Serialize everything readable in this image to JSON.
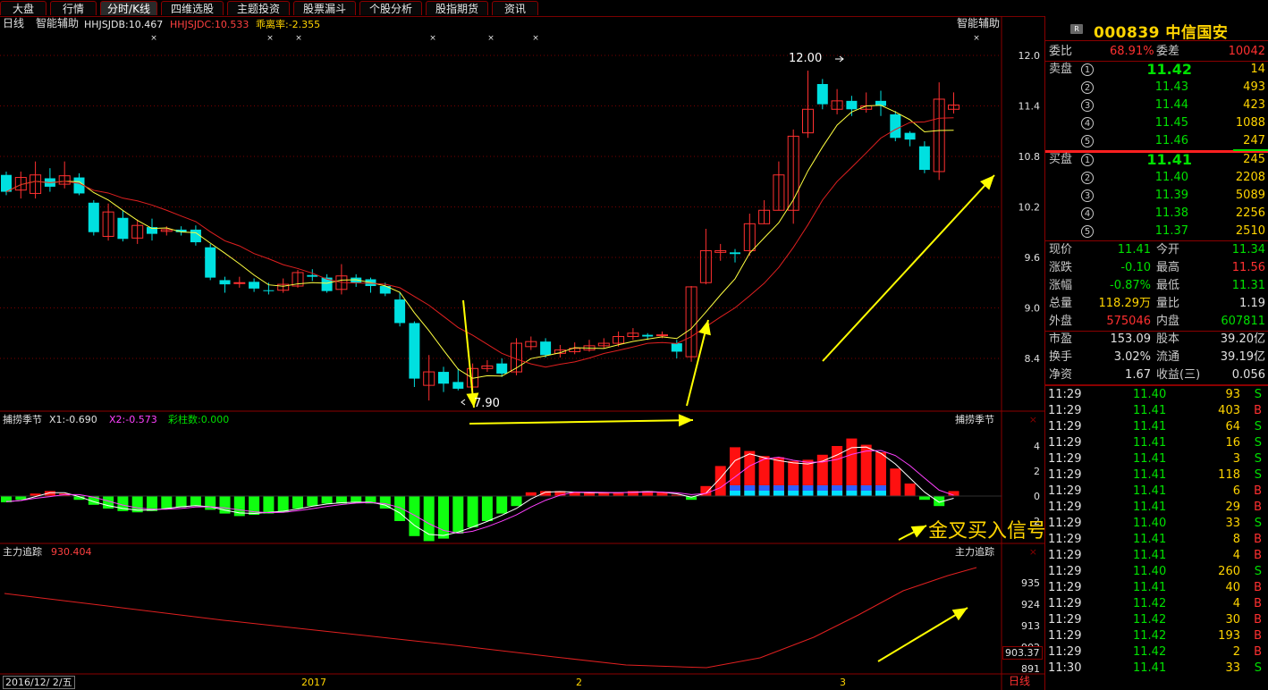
{
  "tabs": [
    "大盘",
    "行情",
    "分时/K线",
    "四维选股",
    "主题投资",
    "股票漏斗",
    "个股分析",
    "股指期货",
    "资讯"
  ],
  "active_tab": "分时/K线",
  "main_pane": {
    "period": "日线",
    "indicator": "智能辅助",
    "hhjsjdb": "HHJSJDB:10.467",
    "hhjsjdc": "HHJSJDC:10.533",
    "deviation": "乖离率:-2.355",
    "right_label": "智能辅助",
    "y_ticks": [
      "12.0",
      "11.4",
      "10.8",
      "10.2",
      "9.6",
      "9.0",
      "8.4"
    ],
    "high_label": "12.00",
    "low_label": "7.90"
  },
  "macd_pane": {
    "name": "捕捞季节",
    "x1": "X1:-0.690",
    "x2": "X2:-0.573",
    "colorbar": "彩柱数:0.000",
    "right_label": "捕捞季节",
    "y_ticks": [
      "4",
      "2",
      "0",
      "-2"
    ],
    "annotation": "金叉买入信号"
  },
  "flow_pane": {
    "name": "主力追踪",
    "value": "930.404",
    "right_label": "主力追踪",
    "y_ticks": [
      "935",
      "924",
      "913",
      "902",
      "891"
    ],
    "current": "903.37"
  },
  "x_axis": {
    "date": "2016/12/ 2/五",
    "labels": [
      "2017",
      "2",
      "3"
    ],
    "period_tag": "日线"
  },
  "stock": {
    "badge": "R",
    "code": "000839",
    "name": "中信国安"
  },
  "order_book": {
    "wb_label": "委比",
    "wb": "68.91%",
    "wc_label": "委差",
    "wc": "10042",
    "sell_label": "卖盘",
    "buy_label": "买盘",
    "asks": [
      {
        "level": "5",
        "price": "11.46",
        "vol": "247"
      },
      {
        "level": "4",
        "price": "11.45",
        "vol": "1088"
      },
      {
        "level": "3",
        "price": "11.44",
        "vol": "423"
      },
      {
        "level": "2",
        "price": "11.43",
        "vol": "493"
      },
      {
        "level": "1",
        "price": "11.42",
        "vol": "14"
      }
    ],
    "bids": [
      {
        "level": "1",
        "price": "11.41",
        "vol": "245"
      },
      {
        "level": "2",
        "price": "11.40",
        "vol": "2208"
      },
      {
        "level": "3",
        "price": "11.39",
        "vol": "5089"
      },
      {
        "level": "4",
        "price": "11.38",
        "vol": "2256"
      },
      {
        "level": "5",
        "price": "11.37",
        "vol": "2510"
      }
    ]
  },
  "quote": [
    {
      "l1": "现价",
      "v1": "11.41",
      "c1": "grn",
      "l2": "今开",
      "v2": "11.34",
      "c2": "grn"
    },
    {
      "l1": "涨跌",
      "v1": "-0.10",
      "c1": "grn",
      "l2": "最高",
      "v2": "11.56",
      "c2": "red"
    },
    {
      "l1": "涨幅",
      "v1": "-0.87%",
      "c1": "grn",
      "l2": "最低",
      "v2": "11.31",
      "c2": "grn"
    },
    {
      "l1": "总量",
      "v1": "118.29万",
      "c1": "yel",
      "l2": "量比",
      "v2": "1.19",
      "c2": "wht"
    },
    {
      "l1": "外盘",
      "v1": "575046",
      "c1": "red",
      "l2": "内盘",
      "v2": "607811",
      "c2": "grn"
    }
  ],
  "stats": [
    {
      "l1": "市盈",
      "v1": "153.09",
      "l2": "股本",
      "v2": "39.20亿"
    },
    {
      "l1": "换手",
      "v1": "3.02%",
      "l2": "流通",
      "v2": "39.19亿"
    },
    {
      "l1": "净资",
      "v1": "1.67",
      "l2": "收益(三)",
      "v2": "0.056"
    }
  ],
  "ticks": [
    {
      "t": "11:29",
      "p": "11.40",
      "v": "93",
      "s": "S"
    },
    {
      "t": "11:29",
      "p": "11.41",
      "v": "403",
      "s": "B"
    },
    {
      "t": "11:29",
      "p": "11.41",
      "v": "64",
      "s": "S"
    },
    {
      "t": "11:29",
      "p": "11.41",
      "v": "16",
      "s": "S"
    },
    {
      "t": "11:29",
      "p": "11.41",
      "v": "3",
      "s": "S"
    },
    {
      "t": "11:29",
      "p": "11.41",
      "v": "118",
      "s": "S"
    },
    {
      "t": "11:29",
      "p": "11.41",
      "v": "6",
      "s": "B"
    },
    {
      "t": "11:29",
      "p": "11.41",
      "v": "29",
      "s": "B"
    },
    {
      "t": "11:29",
      "p": "11.40",
      "v": "33",
      "s": "S"
    },
    {
      "t": "11:29",
      "p": "11.41",
      "v": "8",
      "s": "B"
    },
    {
      "t": "11:29",
      "p": "11.41",
      "v": "4",
      "s": "B"
    },
    {
      "t": "11:29",
      "p": "11.40",
      "v": "260",
      "s": "S"
    },
    {
      "t": "11:29",
      "p": "11.41",
      "v": "40",
      "s": "B"
    },
    {
      "t": "11:29",
      "p": "11.42",
      "v": "4",
      "s": "B"
    },
    {
      "t": "11:29",
      "p": "11.42",
      "v": "30",
      "s": "B"
    },
    {
      "t": "11:29",
      "p": "11.42",
      "v": "193",
      "s": "B"
    },
    {
      "t": "11:29",
      "p": "11.42",
      "v": "2",
      "s": "B"
    },
    {
      "t": "11:30",
      "p": "11.41",
      "v": "33",
      "s": "S"
    }
  ],
  "chart_data": {
    "type": "candlestick",
    "candles": [
      [
        10.58,
        10.38,
        10.62,
        10.34
      ],
      [
        10.4,
        10.55,
        10.62,
        10.3
      ],
      [
        10.36,
        10.58,
        10.74,
        10.3
      ],
      [
        10.54,
        10.44,
        10.66,
        10.38
      ],
      [
        10.47,
        10.57,
        10.74,
        10.42
      ],
      [
        10.55,
        10.36,
        10.6,
        10.34
      ],
      [
        10.25,
        9.9,
        10.28,
        9.86
      ],
      [
        9.85,
        10.14,
        10.24,
        9.8
      ],
      [
        10.07,
        9.82,
        10.16,
        9.79
      ],
      [
        9.83,
        9.98,
        10.05,
        9.76
      ],
      [
        9.96,
        9.88,
        10.06,
        9.8
      ],
      [
        9.91,
        9.93,
        9.97,
        9.86
      ],
      [
        9.93,
        9.9,
        9.97,
        9.86
      ],
      [
        9.93,
        9.78,
        9.98,
        9.74
      ],
      [
        9.72,
        9.36,
        9.76,
        9.33
      ],
      [
        9.33,
        9.28,
        9.37,
        9.18
      ],
      [
        9.3,
        9.3,
        9.37,
        9.24
      ],
      [
        9.31,
        9.23,
        9.35,
        9.19
      ],
      [
        9.21,
        9.2,
        9.3,
        9.16
      ],
      [
        9.21,
        9.28,
        9.35,
        9.18
      ],
      [
        9.26,
        9.42,
        9.45,
        9.24
      ],
      [
        9.39,
        9.37,
        9.46,
        9.32
      ],
      [
        9.36,
        9.2,
        9.4,
        9.18
      ],
      [
        9.22,
        9.38,
        9.52,
        9.16
      ],
      [
        9.36,
        9.3,
        9.4,
        9.25
      ],
      [
        9.34,
        9.26,
        9.36,
        9.18
      ],
      [
        9.26,
        9.17,
        9.3,
        9.14
      ],
      [
        9.1,
        8.82,
        9.18,
        8.78
      ],
      [
        8.82,
        8.16,
        8.84,
        8.06
      ],
      [
        8.08,
        8.24,
        8.44,
        7.9
      ],
      [
        8.24,
        8.1,
        8.3,
        8.0
      ],
      [
        8.12,
        8.04,
        8.28,
        8.02
      ],
      [
        8.06,
        8.28,
        8.34,
        8.02
      ],
      [
        8.28,
        8.31,
        8.38,
        8.24
      ],
      [
        8.34,
        8.22,
        8.4,
        8.18
      ],
      [
        8.24,
        8.58,
        8.64,
        8.2
      ],
      [
        8.54,
        8.6,
        8.66,
        8.5
      ],
      [
        8.6,
        8.44,
        8.64,
        8.41
      ],
      [
        8.46,
        8.5,
        8.56,
        8.41
      ],
      [
        8.48,
        8.52,
        8.59,
        8.45
      ],
      [
        8.5,
        8.55,
        8.62,
        8.48
      ],
      [
        8.55,
        8.58,
        8.64,
        8.52
      ],
      [
        8.58,
        8.66,
        8.72,
        8.54
      ],
      [
        8.66,
        8.7,
        8.76,
        8.62
      ],
      [
        8.68,
        8.66,
        8.7,
        8.62
      ],
      [
        8.68,
        8.68,
        8.72,
        8.64
      ],
      [
        8.58,
        8.48,
        8.62,
        8.4
      ],
      [
        8.42,
        9.25,
        9.26,
        8.36
      ],
      [
        9.3,
        9.68,
        9.94,
        9.28
      ],
      [
        9.66,
        9.68,
        9.76,
        9.56
      ],
      [
        9.66,
        9.64,
        9.7,
        9.54
      ],
      [
        9.68,
        10.0,
        10.12,
        9.62
      ],
      [
        10.0,
        10.16,
        10.28,
        10.0
      ],
      [
        10.16,
        10.58,
        10.74,
        10.16
      ],
      [
        10.16,
        11.04,
        11.12,
        10.0
      ],
      [
        11.08,
        11.36,
        11.82,
        11.02
      ],
      [
        11.66,
        11.42,
        11.72,
        11.36
      ],
      [
        11.36,
        11.46,
        11.6,
        11.3
      ],
      [
        11.46,
        11.36,
        11.52,
        11.28
      ],
      [
        11.36,
        11.4,
        11.56,
        11.32
      ],
      [
        11.46,
        11.4,
        11.58,
        11.28
      ],
      [
        11.3,
        11.02,
        11.34,
        10.98
      ],
      [
        11.08,
        11.0,
        11.1,
        10.92
      ],
      [
        10.92,
        10.64,
        10.98,
        10.6
      ],
      [
        10.62,
        11.48,
        11.68,
        10.52
      ],
      [
        11.36,
        11.41,
        11.56,
        11.31
      ]
    ],
    "price_range": [
      7.9,
      12.0
    ],
    "moving_averages": [
      "yellow",
      "red"
    ],
    "macd_hist": [
      -0.5,
      -0.3,
      0.2,
      0.4,
      0.2,
      -0.3,
      -0.7,
      -1.0,
      -1.2,
      -1.3,
      -1.2,
      -1.0,
      -0.9,
      -0.8,
      -1.1,
      -1.4,
      -1.6,
      -1.5,
      -1.4,
      -1.3,
      -1.0,
      -0.8,
      -0.6,
      -0.6,
      -0.5,
      -0.6,
      -1.0,
      -2.0,
      -3.2,
      -3.6,
      -3.4,
      -3.0,
      -2.5,
      -2.0,
      -1.4,
      -0.8,
      0.3,
      0.4,
      0.4,
      0.3,
      0.3,
      0.3,
      0.3,
      0.4,
      0.4,
      0.3,
      0.1,
      -0.3,
      0.8,
      2.4,
      3.9,
      3.6,
      3.2,
      3.1,
      2.8,
      2.9,
      3.3,
      4.0,
      4.6,
      4.1,
      3.5,
      2.2,
      1.0,
      -0.3,
      -0.8,
      0.4
    ],
    "flow_range": [
      891,
      935
    ]
  }
}
